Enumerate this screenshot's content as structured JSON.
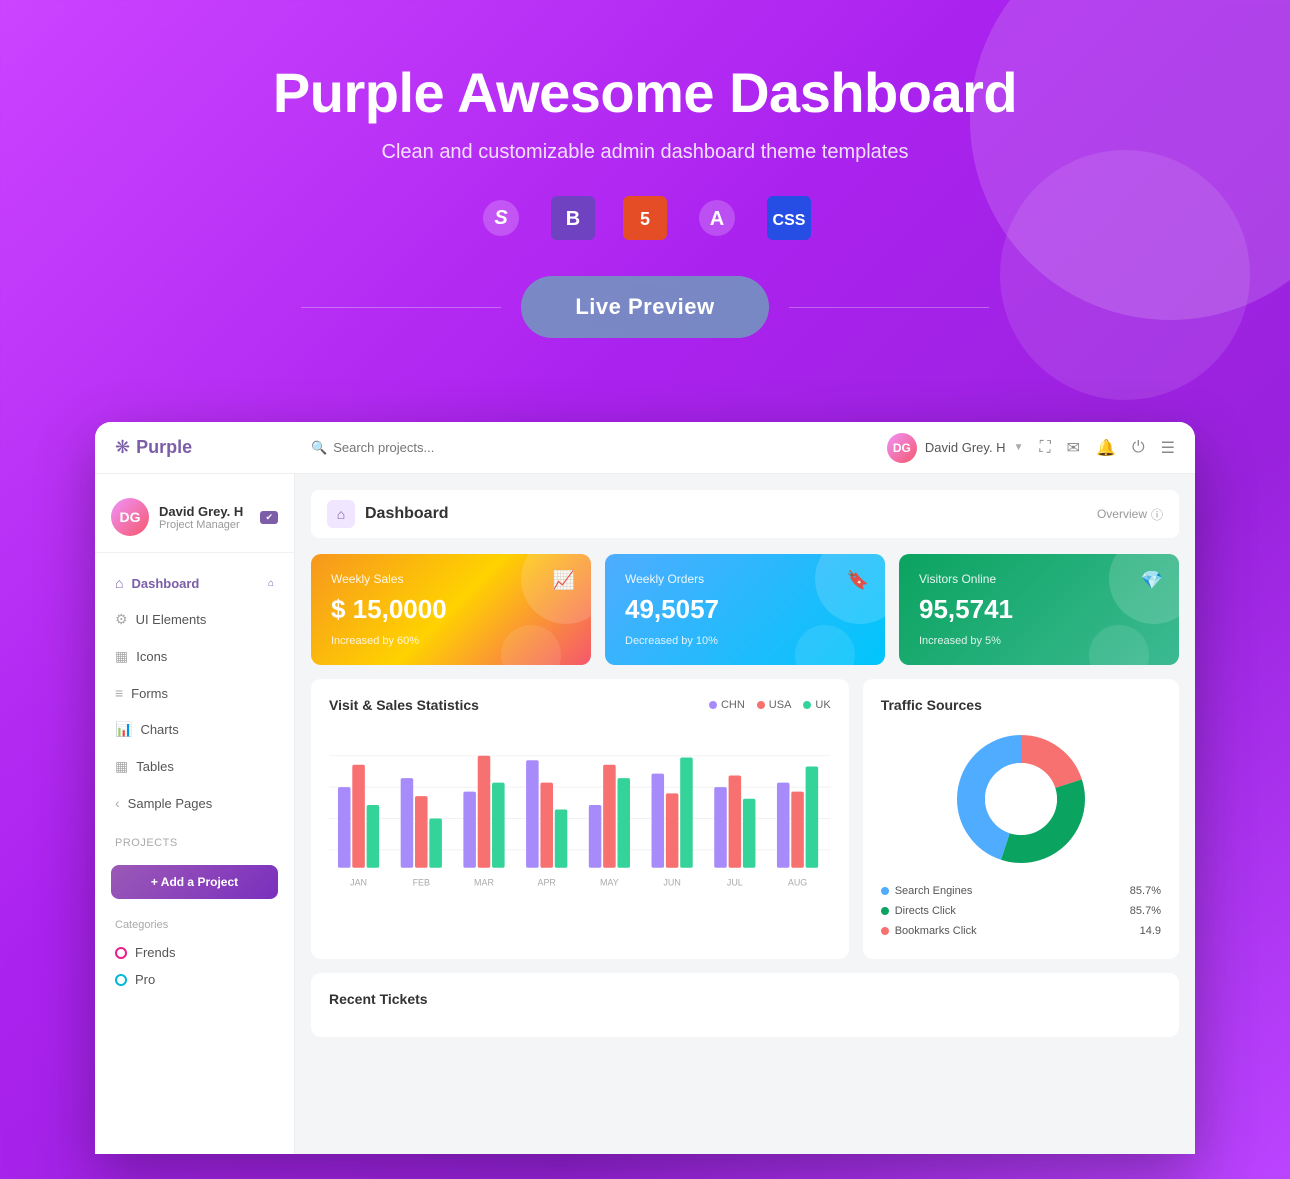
{
  "hero": {
    "title": "Purple Awesome Dashboard",
    "subtitle": "Clean and customizable admin dashboard theme templates",
    "live_preview_label": "Live Preview",
    "tech_icons": [
      {
        "name": "sass-icon",
        "label": "S",
        "type": "sass"
      },
      {
        "name": "bootstrap-icon",
        "label": "B",
        "type": "bootstrap"
      },
      {
        "name": "html5-icon",
        "label": "5",
        "type": "html5"
      },
      {
        "name": "angular-icon",
        "label": "A",
        "type": "angular"
      },
      {
        "name": "css3-icon",
        "label": "3",
        "type": "css3"
      }
    ]
  },
  "navbar": {
    "logo_text": "Purple",
    "search_placeholder": "Search projects...",
    "user_name": "David Grey. H",
    "user_role": "Project Manager"
  },
  "sidebar": {
    "user_name": "David Grey. H",
    "user_role": "Project Manager",
    "nav_items": [
      {
        "label": "Dashboard",
        "active": true
      },
      {
        "label": "UI Elements",
        "active": false
      },
      {
        "label": "Icons",
        "active": false
      },
      {
        "label": "Forms",
        "active": false
      },
      {
        "label": "Charts",
        "active": false
      },
      {
        "label": "Tables",
        "active": false
      },
      {
        "label": "Sample Pages",
        "active": false
      }
    ],
    "projects_section": "Projects",
    "add_project_label": "+ Add a Project",
    "categories_section": "Categories",
    "categories": [
      {
        "label": "Frends",
        "color": "pink"
      },
      {
        "label": "Pro",
        "color": "blue"
      }
    ]
  },
  "dashboard": {
    "title": "Dashboard",
    "header_right": "Overview",
    "stats": [
      {
        "label": "Weekly Sales",
        "value": "$ 15,0000",
        "change": "Increased by 60%",
        "type": "orange"
      },
      {
        "label": "Weekly Orders",
        "value": "49,5057",
        "change": "Decreased by 10%",
        "type": "blue"
      },
      {
        "label": "Visitors Online",
        "value": "95,5741",
        "change": "Increased by 5%",
        "type": "teal"
      }
    ],
    "bar_chart": {
      "title": "Visit & Sales Statistics",
      "legend": [
        {
          "label": "CHN",
          "color": "#a78bfa"
        },
        {
          "label": "USA",
          "color": "#f87171"
        },
        {
          "label": "UK",
          "color": "#34d399"
        }
      ],
      "months": [
        "JAN",
        "FEB",
        "MAR",
        "APR",
        "MAY",
        "JUN",
        "JUL",
        "AUG"
      ],
      "bars": [
        {
          "chn": 70,
          "usa": 85,
          "uk": 55
        },
        {
          "chn": 80,
          "usa": 60,
          "uk": 40
        },
        {
          "chn": 65,
          "usa": 90,
          "uk": 70
        },
        {
          "chn": 95,
          "usa": 75,
          "uk": 50
        },
        {
          "chn": 55,
          "usa": 85,
          "uk": 80
        },
        {
          "chn": 85,
          "usa": 65,
          "uk": 90
        },
        {
          "chn": 70,
          "usa": 80,
          "uk": 60
        },
        {
          "chn": 75,
          "usa": 70,
          "uk": 85
        }
      ]
    },
    "donut_chart": {
      "title": "Traffic Sources",
      "segments": [
        {
          "label": "Search Engines",
          "value": 85.7,
          "color": "#4facfe",
          "percent": 45
        },
        {
          "label": "Directs Click",
          "value": 85.7,
          "color": "#0ba360",
          "percent": 35
        },
        {
          "label": "Bookmarks Click",
          "value": 14.9,
          "color": "#f87171",
          "percent": 20
        }
      ]
    },
    "recent_tickets_title": "Recent Tickets"
  },
  "colors": {
    "accent": "#7b5ea7",
    "orange_card": "#f7971e",
    "blue_card": "#4facfe",
    "teal_card": "#0ba360"
  }
}
